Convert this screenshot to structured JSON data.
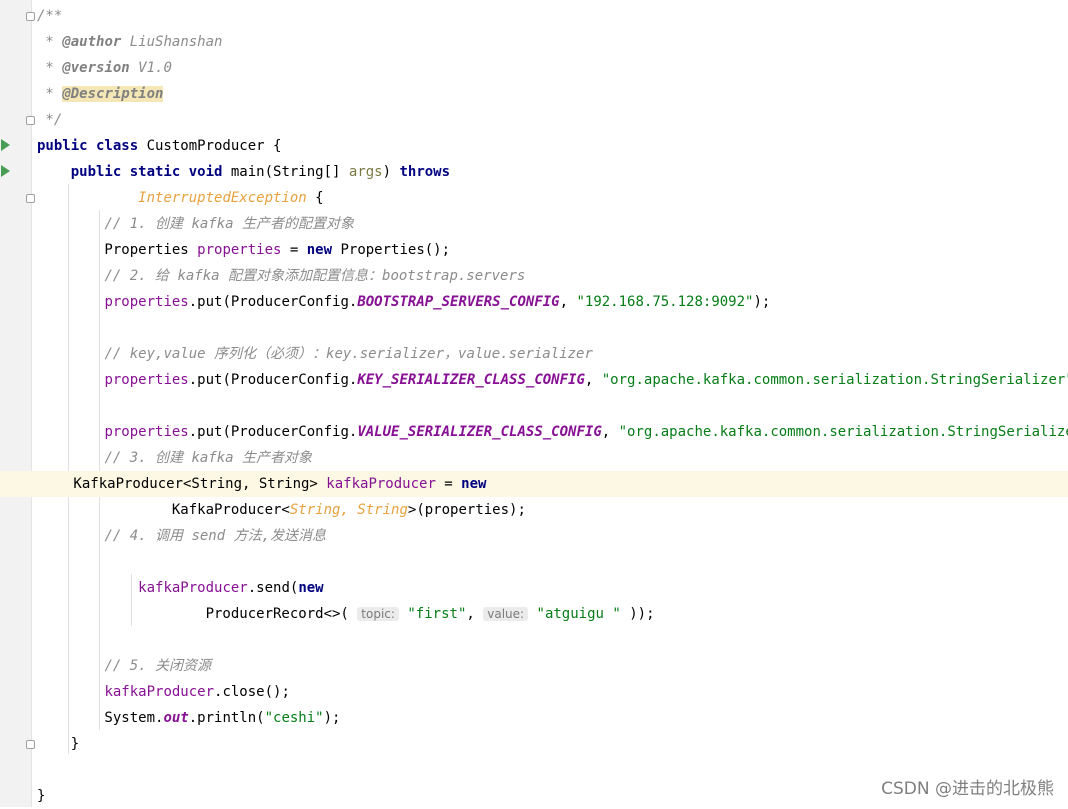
{
  "editor": {
    "language": "java",
    "lines": [
      {
        "tokens": [
          {
            "t": "/**",
            "c": "doc"
          }
        ]
      },
      {
        "tokens": [
          {
            "t": " * ",
            "c": "doc"
          },
          {
            "t": "@author",
            "c": "tag"
          },
          {
            "t": " LiuShanshan",
            "c": "doc"
          }
        ]
      },
      {
        "tokens": [
          {
            "t": " * ",
            "c": "doc"
          },
          {
            "t": "@version",
            "c": "tag"
          },
          {
            "t": " V1.0",
            "c": "doc"
          }
        ]
      },
      {
        "tokens": [
          {
            "t": " * ",
            "c": "doc"
          },
          {
            "t": "@Description",
            "c": "tag desc"
          }
        ]
      },
      {
        "tokens": [
          {
            "t": " */",
            "c": "doc"
          }
        ]
      },
      {
        "tokens": [
          {
            "t": "public class ",
            "c": "kw"
          },
          {
            "t": "CustomProducer {",
            "c": ""
          }
        ]
      },
      {
        "tokens": [
          {
            "t": "    "
          },
          {
            "t": "public static void ",
            "c": "kw"
          },
          {
            "t": "main(String[] ",
            "c": ""
          },
          {
            "t": "args",
            "c": "param"
          },
          {
            "t": ") ",
            "c": ""
          },
          {
            "t": "throws",
            "c": "kw"
          }
        ]
      },
      {
        "tokens": [
          {
            "t": "            "
          },
          {
            "t": "InterruptedException",
            "c": "exc"
          },
          {
            "t": " {",
            "c": ""
          }
        ]
      },
      {
        "tokens": [
          {
            "t": "        "
          },
          {
            "t": "// 1. 创建 kafka 生产者的配置对象",
            "c": "cm"
          }
        ]
      },
      {
        "tokens": [
          {
            "t": "        Properties "
          },
          {
            "t": "properties",
            "c": "var"
          },
          {
            "t": " = "
          },
          {
            "t": "new ",
            "c": "kw"
          },
          {
            "t": "Properties();"
          }
        ]
      },
      {
        "tokens": [
          {
            "t": "        "
          },
          {
            "t": "// 2. 给 kafka 配置对象添加配置信息：bootstrap.servers",
            "c": "cm"
          }
        ]
      },
      {
        "tokens": [
          {
            "t": "        "
          },
          {
            "t": "properties",
            "c": "var"
          },
          {
            "t": ".put(ProducerConfig."
          },
          {
            "t": "BOOTSTRAP_SERVERS_CONFIG",
            "c": "field"
          },
          {
            "t": ", "
          },
          {
            "t": "\"192.168.75.128:9092\"",
            "c": "str"
          },
          {
            "t": ");"
          }
        ]
      },
      {
        "tokens": []
      },
      {
        "tokens": [
          {
            "t": "        "
          },
          {
            "t": "// key,value 序列化（必须）：key.serializer，value.serializer",
            "c": "cm"
          }
        ]
      },
      {
        "tokens": [
          {
            "t": "        "
          },
          {
            "t": "properties",
            "c": "var"
          },
          {
            "t": ".put(ProducerConfig."
          },
          {
            "t": "KEY_SERIALIZER_CLASS_CONFIG",
            "c": "field"
          },
          {
            "t": ", "
          },
          {
            "t": "\"org.apache.kafka.common.serialization.StringSerializer\"",
            "c": "str"
          },
          {
            "t": ");"
          }
        ]
      },
      {
        "tokens": []
      },
      {
        "tokens": [
          {
            "t": "        "
          },
          {
            "t": "properties",
            "c": "var"
          },
          {
            "t": ".put(ProducerConfig."
          },
          {
            "t": "VALUE_SERIALIZER_CLASS_CONFIG",
            "c": "field"
          },
          {
            "t": ", "
          },
          {
            "t": "\"org.apache.kafka.common.serialization.StringSerializer\"",
            "c": "str"
          },
          {
            "t": ");"
          }
        ]
      },
      {
        "tokens": [
          {
            "t": "        "
          },
          {
            "t": "// 3. 创建 kafka 生产者对象",
            "c": "cm"
          }
        ]
      },
      {
        "tokens": [
          {
            "t": "        KafkaProducer<String, String> "
          },
          {
            "t": "kafkaProducer",
            "c": "var"
          },
          {
            "t": " = "
          },
          {
            "t": "new",
            "c": "kw"
          }
        ],
        "highlight": true
      },
      {
        "tokens": [
          {
            "t": "                KafkaProducer<"
          },
          {
            "t": "String, String",
            "c": "tparam"
          },
          {
            "t": ">(properties);"
          }
        ]
      },
      {
        "tokens": [
          {
            "t": "        "
          },
          {
            "t": "// 4. 调用 send 方法,发送消息",
            "c": "cm"
          }
        ]
      },
      {
        "tokens": []
      },
      {
        "tokens": [
          {
            "t": "            "
          },
          {
            "t": "kafkaProducer",
            "c": "var"
          },
          {
            "t": ".send("
          },
          {
            "t": "new",
            "c": "kw"
          }
        ]
      },
      {
        "tokens": [
          {
            "t": "                    ProducerRecord<>( "
          },
          {
            "t": "topic:",
            "c": "hint"
          },
          {
            "t": " "
          },
          {
            "t": "\"first\"",
            "c": "str"
          },
          {
            "t": ", "
          },
          {
            "t": "value:",
            "c": "hint"
          },
          {
            "t": " "
          },
          {
            "t": "\"atguigu \"",
            "c": "str"
          },
          {
            "t": " ));"
          }
        ]
      },
      {
        "tokens": []
      },
      {
        "tokens": [
          {
            "t": "        "
          },
          {
            "t": "// 5. 关闭资源",
            "c": "cm"
          }
        ]
      },
      {
        "tokens": [
          {
            "t": "        "
          },
          {
            "t": "kafkaProducer",
            "c": "var"
          },
          {
            "t": ".close();"
          }
        ]
      },
      {
        "tokens": [
          {
            "t": "        System."
          },
          {
            "t": "out",
            "c": "field"
          },
          {
            "t": ".println("
          },
          {
            "t": "\"ceshi\"",
            "c": "str"
          },
          {
            "t": ");"
          }
        ]
      },
      {
        "tokens": [
          {
            "t": "    }"
          }
        ]
      },
      {
        "tokens": []
      },
      {
        "tokens": [
          {
            "t": "}"
          }
        ]
      }
    ]
  },
  "watermark": "CSDN @进击的北极熊"
}
